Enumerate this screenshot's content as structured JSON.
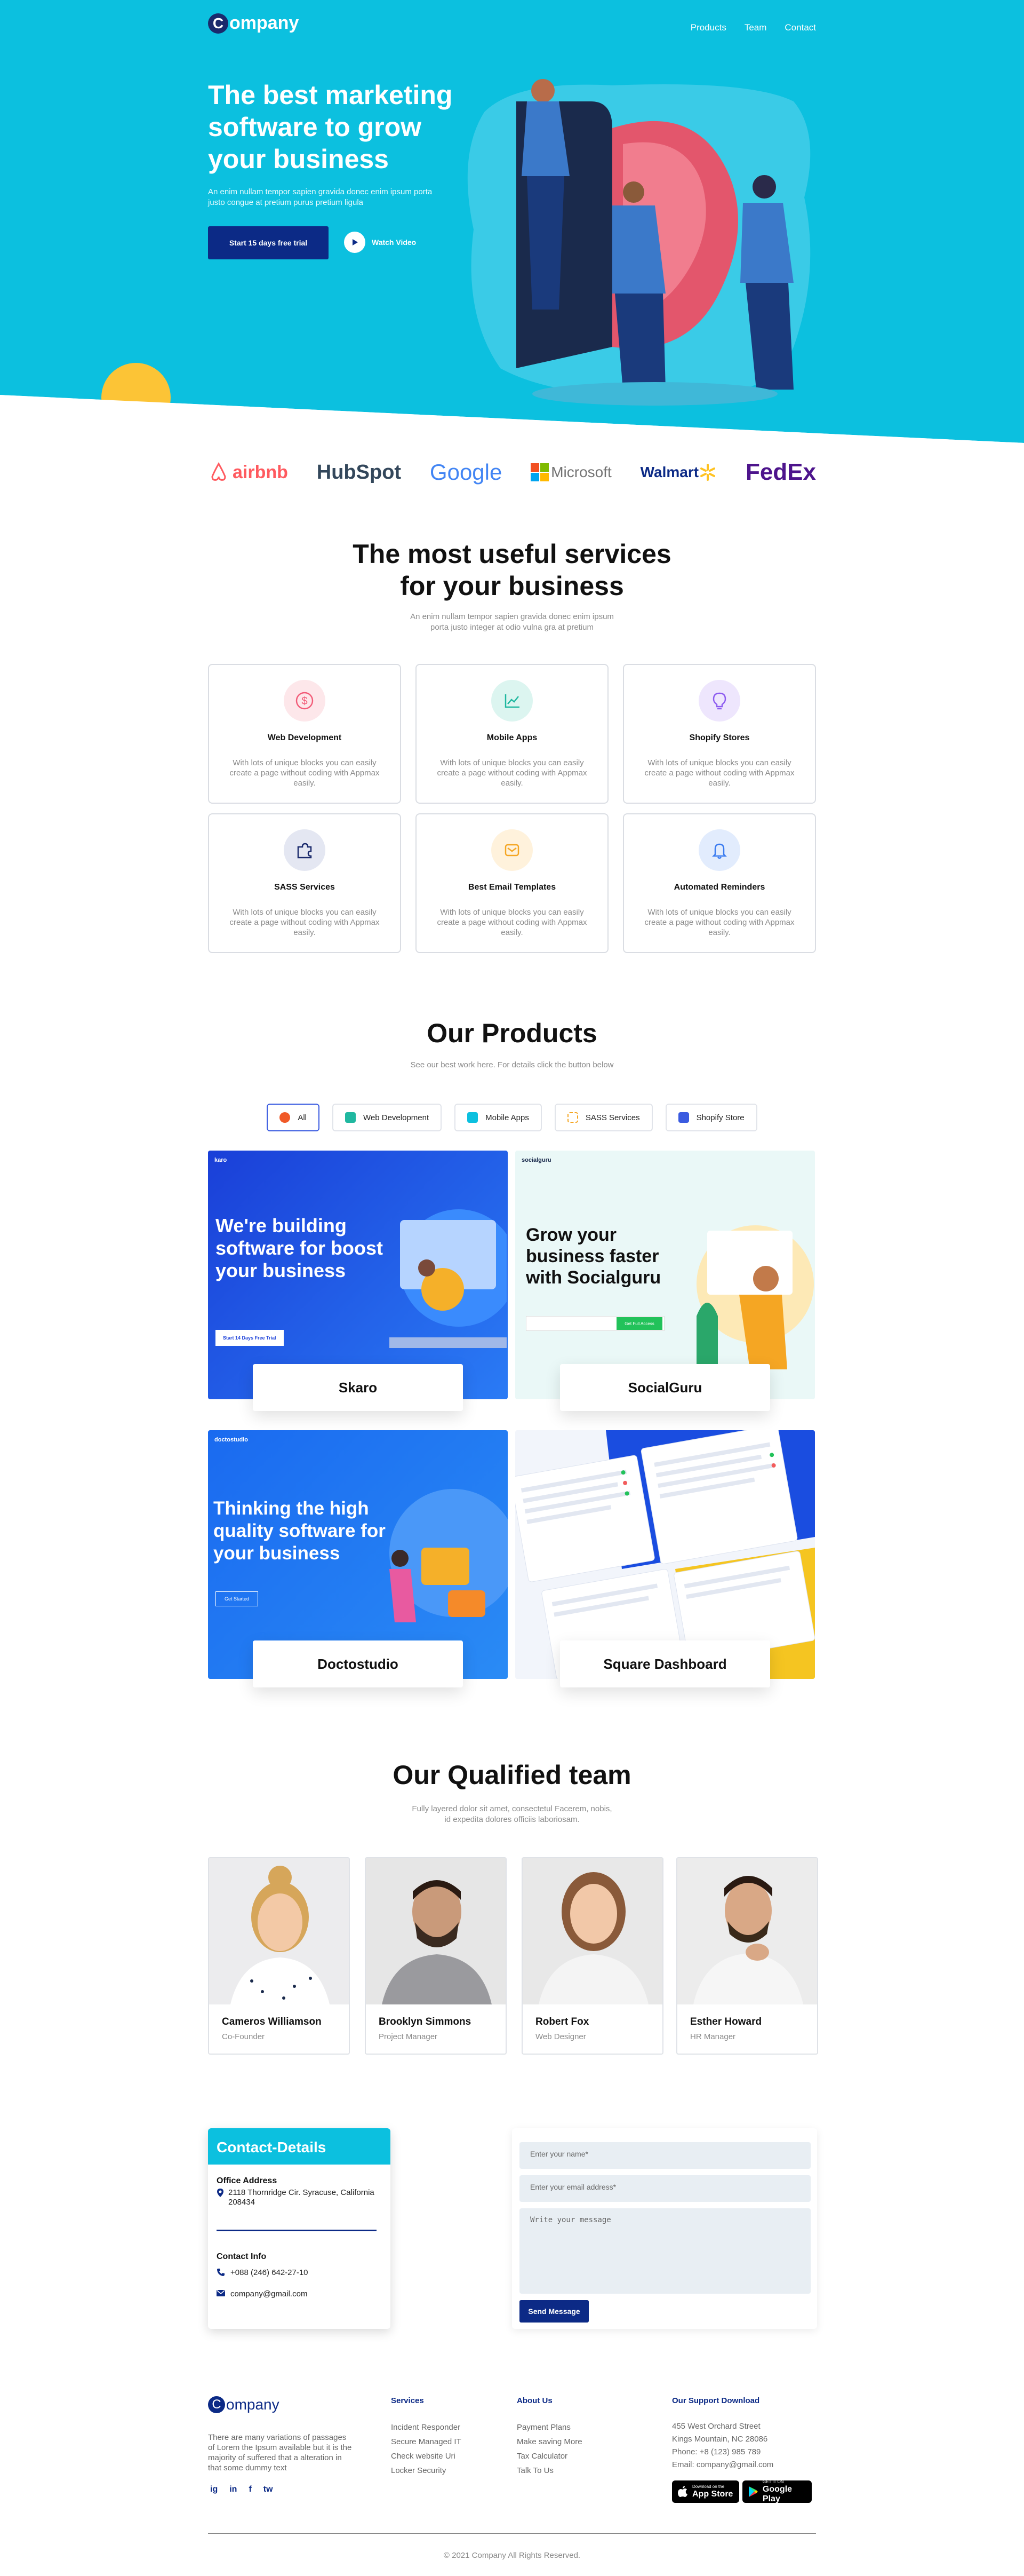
{
  "nav": {
    "logo_letter": "C",
    "logo_text": "ompany",
    "links": [
      "Products",
      "Team",
      "Contact"
    ]
  },
  "hero": {
    "title": "The best marketing software to grow your business",
    "subtitle": "An enim nullam tempor sapien gravida donec enim ipsum porta justo congue at pretium purus pretium ligula",
    "cta": "Start 15 days free trial",
    "watch": "Watch Video"
  },
  "brands": [
    "airbnb",
    "HubSpot",
    "Google",
    "Microsoft",
    "Walmart",
    "FedEx"
  ],
  "services": {
    "title_line1": "The most useful services",
    "title_line2": "for your business",
    "subtitle_line1": "An enim nullam tempor sapien gravida donec enim ipsum",
    "subtitle_line2": "porta justo integer at odio vulna gra at pretium",
    "items": [
      {
        "title": "Web Development",
        "desc": "With lots of unique blocks you can easily create a page without coding with Appmax easily.",
        "icon": "dollar-icon",
        "color": "#f25c78"
      },
      {
        "title": "Mobile Apps",
        "desc": "With lots of unique blocks you can easily create a page without coding with Appmax easily.",
        "icon": "chart-icon",
        "color": "#20b8a0"
      },
      {
        "title": "Shopify Stores",
        "desc": "With lots of unique blocks you can easily create a page without coding with Appmax easily.",
        "icon": "bulb-icon",
        "color": "#8d5cf0"
      },
      {
        "title": "SASS Services",
        "desc": "With lots of unique blocks you can easily create a page without coding with Appmax easily.",
        "icon": "puzzle-icon",
        "color": "#1a2a6c"
      },
      {
        "title": "Best Email Templates",
        "desc": "With lots of unique blocks you can easily create a page without coding with Appmax easily.",
        "icon": "mail-icon",
        "color": "#f5a623"
      },
      {
        "title": "Automated Reminders",
        "desc": "With lots of unique blocks you can easily create a page without coding with Appmax easily.",
        "icon": "bell-icon",
        "color": "#3a7bf0"
      }
    ]
  },
  "products": {
    "title": "Our Products",
    "subtitle": "See our best work here. For details click the button below",
    "filters": [
      "All",
      "Web Development",
      "Mobile Apps",
      "SASS Services",
      "Shopify Store"
    ],
    "items": [
      {
        "name": "Skaro",
        "headline": "We're building software for boost your business",
        "brand": "karo",
        "cta": "Start 14 Days Free Trial"
      },
      {
        "name": "SocialGuru",
        "headline": "Grow your business faster with Socialguru",
        "brand": "socialguru",
        "cta": "Get Full Access"
      },
      {
        "name": "Doctostudio",
        "headline": "Thinking the high quality software for your business",
        "brand": "doctostudio",
        "cta": "Get Started"
      },
      {
        "name": "Square Dashboard"
      }
    ]
  },
  "team": {
    "title": "Our Qualified team",
    "subtitle_line1": "Fully layered dolor sit amet, consectetul Facerem, nobis,",
    "subtitle_line2": "id expedita dolores officiis laboriosam.",
    "members": [
      {
        "name": "Cameros Williamson",
        "role": "Co-Founder"
      },
      {
        "name": "Brooklyn Simmons",
        "role": "Project Manager"
      },
      {
        "name": "Robert Fox",
        "role": "Web Designer"
      },
      {
        "name": "Esther Howard",
        "role": "HR Manager"
      }
    ]
  },
  "contact": {
    "title": "Contact-Details",
    "office_label": "Office Address",
    "office": "2118 Thornridge Cir. Syracuse, California 208434",
    "info_label": "Contact Info",
    "phone": "+088 (246) 642-27-10",
    "email": "company@gmail.com"
  },
  "form": {
    "name_ph": "Enter your name*",
    "email_ph": "Enter your email address*",
    "message_ph": "Write your message",
    "send": "Send Message"
  },
  "footer": {
    "logo_letter": "C",
    "logo_text": "ompany",
    "about": "There are many variations of passages of Lorem the Ipsum available but it is the majority of suffered that a alteration in that some dummy text",
    "social": [
      "ig",
      "in",
      "f",
      "tw"
    ],
    "services_title": "Services",
    "services": [
      "Incident Responder",
      "Secure Managed IT",
      "Check website Uri",
      "Locker Security"
    ],
    "about_title": "About Us",
    "about_links": [
      "Payment Plans",
      "Make saving More",
      "Tax Calculator",
      "Talk To Us"
    ],
    "support_title": "Our Support Download",
    "support": [
      "455 West Orchard Street",
      "Kings Mountain, NC 28086",
      "Phone: +8 (123) 985 789",
      "Email: company@gmail.com"
    ],
    "appstore_small": "Download on the",
    "appstore": "App Store",
    "googleplay_small": "GET IT ON",
    "googleplay": "Google Play",
    "copyright": "© 2021 Company All Rights Reserved."
  },
  "colors": {
    "accent": "#0cc0df",
    "navy": "#0c2a86",
    "yellow": "#fcc436"
  }
}
